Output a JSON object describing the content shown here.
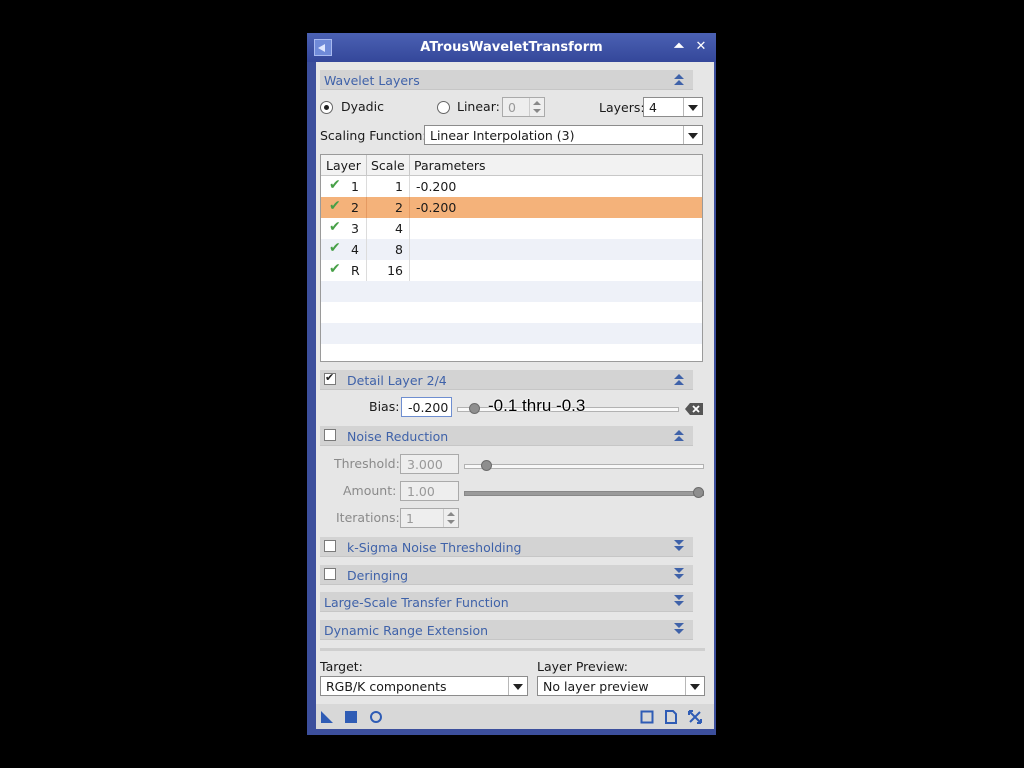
{
  "window": {
    "title": "ATrousWaveletTransform"
  },
  "wavelet_layers": {
    "section_label": "Wavelet Layers",
    "dyadic_label": "Dyadic",
    "linear_label": "Linear:",
    "linear_value": "0",
    "layers_label": "Layers:",
    "layers_value": "4",
    "scaling_label": "Scaling Function:",
    "scaling_value": "Linear Interpolation (3)",
    "table": {
      "headers": [
        "Layer",
        "Scale",
        "Parameters"
      ],
      "rows": [
        {
          "layer": "1",
          "scale": "1",
          "params": "-0.200",
          "checked": true,
          "selected": false
        },
        {
          "layer": "2",
          "scale": "2",
          "params": "-0.200",
          "checked": true,
          "selected": true
        },
        {
          "layer": "3",
          "scale": "4",
          "params": "",
          "checked": true,
          "selected": false
        },
        {
          "layer": "4",
          "scale": "8",
          "params": "",
          "checked": true,
          "selected": false
        },
        {
          "layer": "R",
          "scale": "16",
          "params": "",
          "checked": true,
          "selected": false
        }
      ]
    }
  },
  "detail_layer": {
    "section_label": "Detail Layer 2/4",
    "bias_label": "Bias:",
    "bias_value": "-0.200",
    "overlay_note": "-0.1 thru -0.3"
  },
  "noise_reduction": {
    "section_label": "Noise Reduction",
    "threshold_label": "Threshold:",
    "threshold_value": "3.000",
    "amount_label": "Amount:",
    "amount_value": "1.00",
    "iterations_label": "Iterations:",
    "iterations_value": "1"
  },
  "collapsed_sections": {
    "ksigma": "k-Sigma Noise Thresholding",
    "deringing": "Deringing",
    "large_scale": "Large-Scale Transfer Function",
    "dynamic_range": "Dynamic Range Extension"
  },
  "bottom": {
    "target_label": "Target:",
    "target_value": "RGB/K components",
    "preview_label": "Layer Preview:",
    "preview_value": "No layer preview"
  },
  "colors": {
    "title_bar": "#3c4f9c",
    "section_text": "#3f62a9",
    "selected_row": "#f4b27a"
  }
}
